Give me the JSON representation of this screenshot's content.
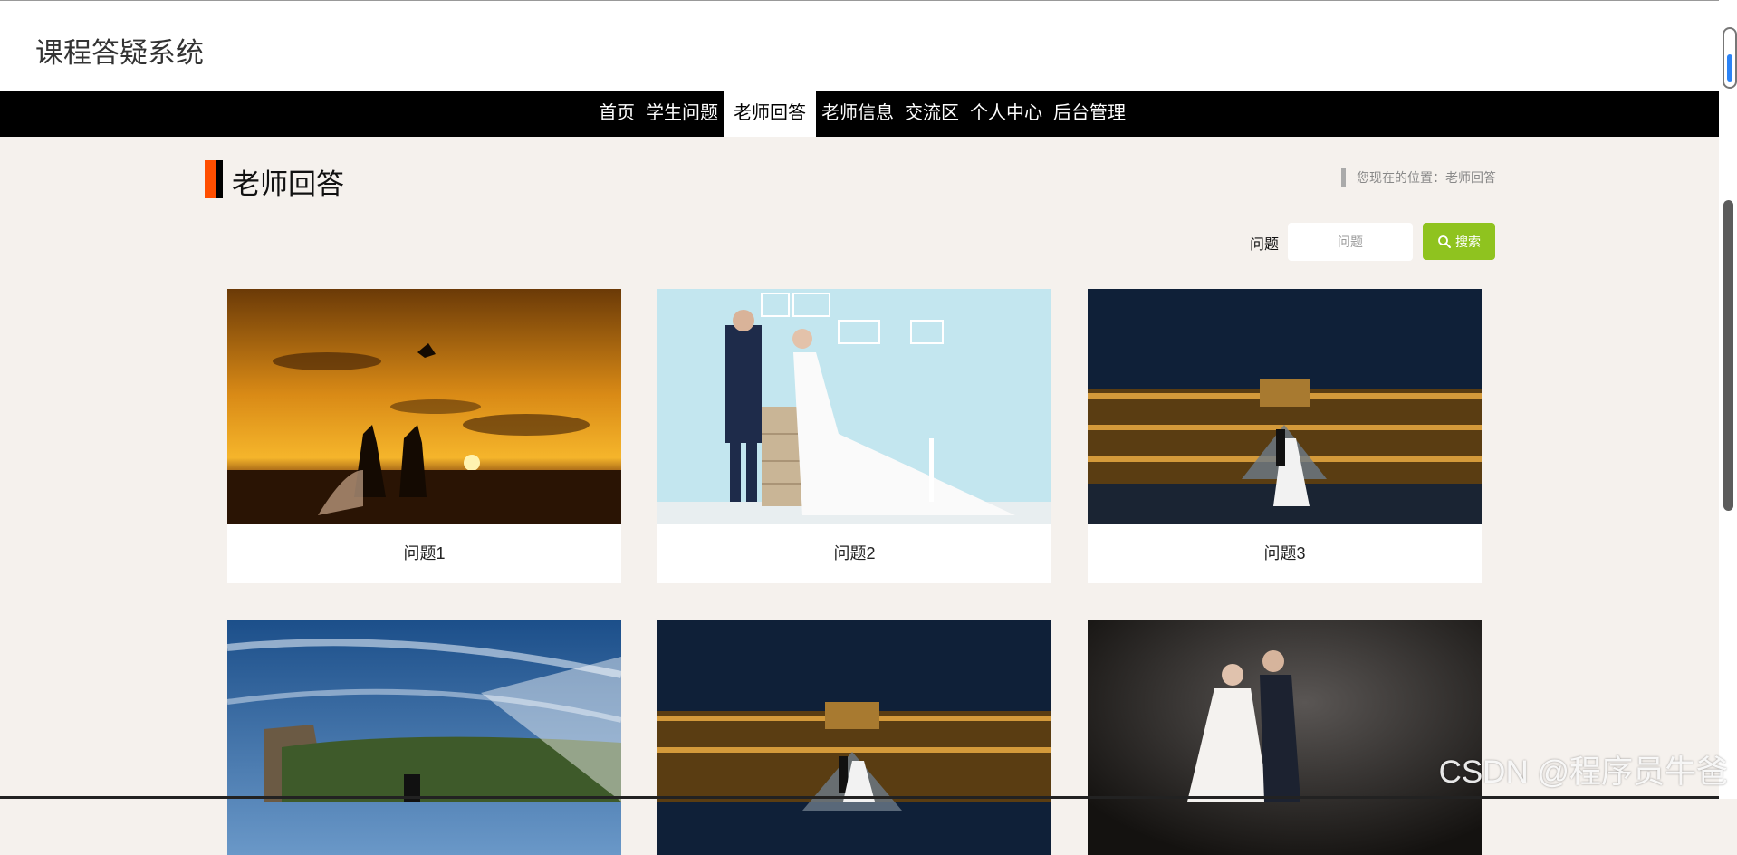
{
  "header": {
    "site_title": "课程答疑系统"
  },
  "nav": {
    "items": [
      {
        "label": "首页",
        "active": false
      },
      {
        "label": "学生问题",
        "active": false
      },
      {
        "label": "老师回答",
        "active": true
      },
      {
        "label": "老师信息",
        "active": false
      },
      {
        "label": "交流区",
        "active": false
      },
      {
        "label": "个人中心",
        "active": false
      },
      {
        "label": "后台管理",
        "active": false
      }
    ]
  },
  "page": {
    "title": "老师回答",
    "breadcrumb": "您现在的位置：老师回答"
  },
  "search": {
    "label": "问题",
    "placeholder": "问题",
    "button_label": "搜索",
    "button_icon": "search-icon"
  },
  "cards": [
    {
      "caption": "问题1"
    },
    {
      "caption": "问题2"
    },
    {
      "caption": "问题3"
    },
    {
      "caption": ""
    },
    {
      "caption": ""
    },
    {
      "caption": ""
    }
  ],
  "colors": {
    "accent": "#ff4e00",
    "search_button": "#8fc31f",
    "nav_bg": "#000000",
    "page_bg": "#f5f1ed"
  },
  "watermark": "CSDN @程序员牛爸"
}
